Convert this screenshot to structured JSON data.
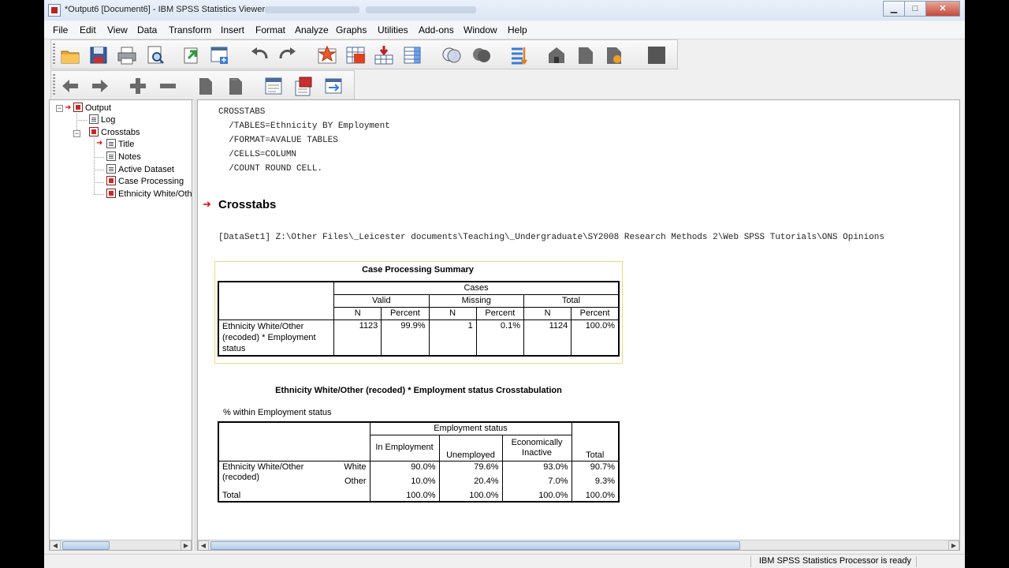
{
  "window": {
    "title": "*Output6 [Document6] - IBM SPSS Statistics Viewer",
    "minimize": "▁",
    "maximize": "□",
    "close": "✕"
  },
  "menu": [
    "File",
    "Edit",
    "View",
    "Data",
    "Transform",
    "Insert",
    "Format",
    "Analyze",
    "Graphs",
    "Utilities",
    "Add-ons",
    "Window",
    "Help"
  ],
  "toolbar1": [
    "open-icon",
    "save-icon",
    "print-icon",
    "print-preview-icon",
    "export-icon",
    "recall-dialog-icon",
    "undo-icon",
    "redo-icon",
    "goto-case-icon",
    "goto-variable-icon",
    "insert-cases-icon",
    "variables-icon",
    "select-cases-icon",
    "split-file-icon",
    "weight-cases-icon",
    "designate-window-icon",
    "insert-heading-icon",
    "insert-title-icon",
    "insert-text-icon",
    "script-icon",
    "blank-icon"
  ],
  "toolbar2": [
    "promote-icon",
    "demote-icon",
    "expand-icon",
    "collapse-icon",
    "show-icon",
    "hide-icon",
    "insert-heading-icon",
    "insert-title-icon",
    "insert-text-icon"
  ],
  "outline": {
    "root": "Output",
    "log": "Log",
    "crosstabs": "Crosstabs",
    "children": [
      "Title",
      "Notes",
      "Active Dataset",
      "Case Processing",
      "Ethnicity White/Oth"
    ]
  },
  "syntax": [
    "CROSSTABS",
    "  /TABLES=Ethnicity BY Employment",
    "  /FORMAT=AVALUE TABLES",
    "  /CELLS=COLUMN",
    "  /COUNT ROUND CELL."
  ],
  "heading": "Crosstabs",
  "dataset_line": "[DataSet1] Z:\\Other Files\\_Leicester documents\\Teaching\\_Undergraduate\\SY2008 Research Methods 2\\Web SPSS Tutorials\\ONS Opinions",
  "summary_table": {
    "title": "Case Processing Summary",
    "cases": "Cases",
    "groups": [
      "Valid",
      "Missing",
      "Total"
    ],
    "sub": [
      "N",
      "Percent",
      "N",
      "Percent",
      "N",
      "Percent"
    ],
    "row_label": "Ethnicity White/Other (recoded) * Employment status",
    "values": [
      "1123",
      "99.9%",
      "1",
      "0.1%",
      "1124",
      "100.0%"
    ]
  },
  "crosstab": {
    "title": "Ethnicity White/Other (recoded) * Employment status Crosstabulation",
    "caption": "% within Employment status",
    "col_group": "Employment status",
    "cols": [
      "In Employment",
      "Unemployed",
      "Economically Inactive",
      "Total"
    ],
    "row_var": "Ethnicity White/Other (recoded)",
    "rows": [
      {
        "label": "White",
        "values": [
          "90.0%",
          "79.6%",
          "93.0%",
          "90.7%"
        ]
      },
      {
        "label": "Other",
        "values": [
          "10.0%",
          "20.4%",
          "7.0%",
          "9.3%"
        ]
      }
    ],
    "total_label": "Total",
    "total_values": [
      "100.0%",
      "100.0%",
      "100.0%",
      "100.0%"
    ]
  },
  "status": "IBM SPSS Statistics Processor is ready"
}
